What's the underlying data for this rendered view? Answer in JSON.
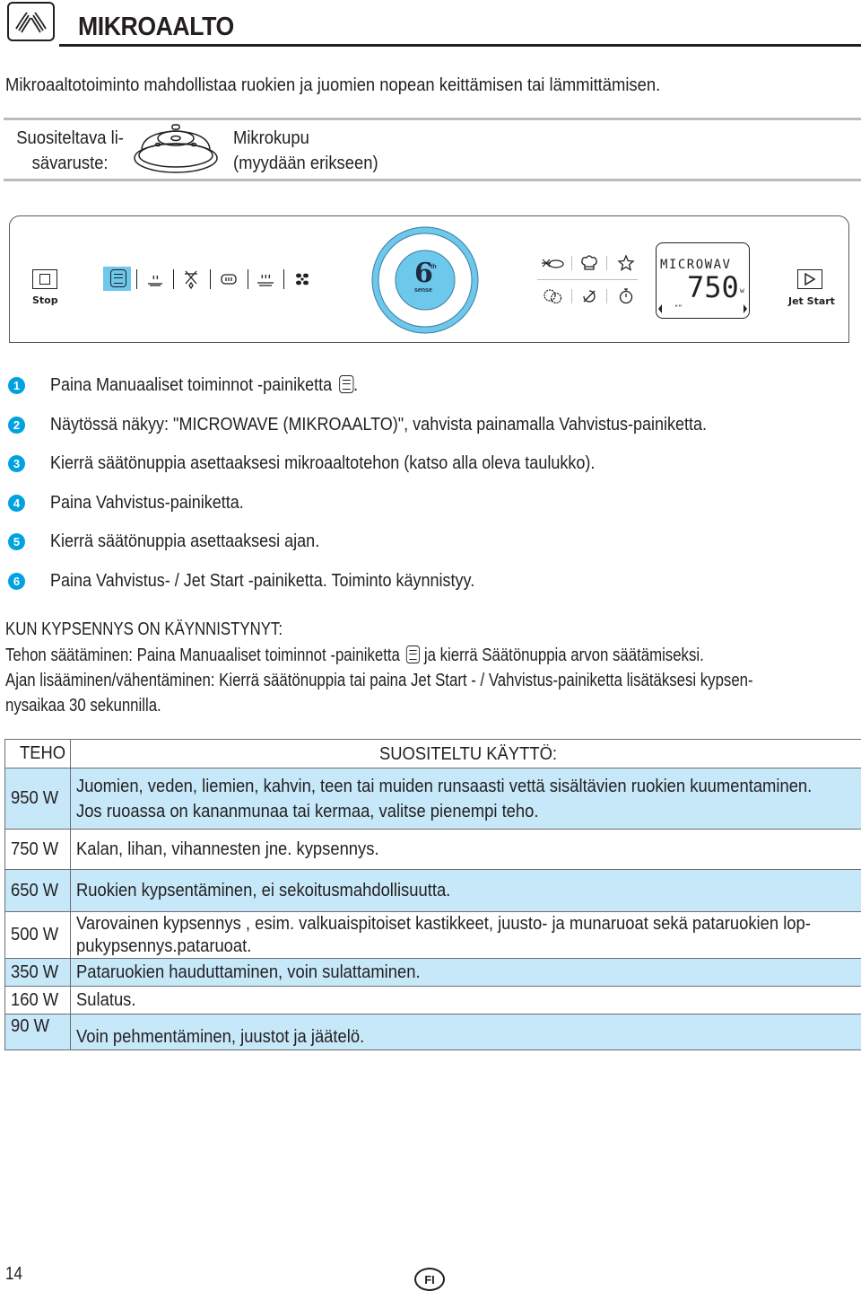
{
  "header": {
    "icon": "microwave-waves-icon",
    "title": "MIKROAALTO"
  },
  "intro": "Mikroaaltotoiminto mahdollistaa ruokien ja juomien nopean keittämisen tai lämmittämisen.",
  "accessory": {
    "label_line1": "Suositeltava li-",
    "label_line2": "sävaruste:",
    "image": "microwave-cover-icon",
    "name_line1": "Mikrokupu",
    "name_line2": "(myydään erikseen)"
  },
  "panel": {
    "stop_label": "Stop",
    "jet_start_label": "Jet Start",
    "function_icons": [
      "manual-functions-icon",
      "steam-icon",
      "defrost-icon",
      "grill-crisp-icon",
      "steam-crisp-icon",
      "fan-icon"
    ],
    "knob_label_main": "6",
    "knob_label_sup": "th",
    "knob_label_sub": "sense",
    "right_icons_top": [
      "bread-defrost-icon",
      "chef-hat-icon",
      "star-icon"
    ],
    "right_icons_bottom": [
      "gears-icon",
      "auto-clean-icon",
      "timer-icon"
    ],
    "display": {
      "text": "MICROWAV",
      "value": "750",
      "unit": "w"
    },
    "accent_color": "#6dc8ec"
  },
  "steps": [
    {
      "num": "1",
      "text": "Paina Manuaaliset toiminnot -painiketta",
      "suffix": "."
    },
    {
      "num": "2",
      "text": "Näytössä näkyy: \"MICROWAVE (MIKROAALTO)\", vahvista painamalla Vahvistus-painiketta."
    },
    {
      "num": "3",
      "text": "Kierrä säätönuppia asettaaksesi mikroaaltotehon (katso alla oleva taulukko)."
    },
    {
      "num": "4",
      "text": "Paina Vahvistus-painiketta."
    },
    {
      "num": "5",
      "text": "Kierrä säätönuppia  asettaaksesi ajan."
    },
    {
      "num": "6",
      "text": "Paina Vahvistus- / Jet Start -painiketta. Toiminto käynnistyy."
    }
  ],
  "after_start": {
    "heading": "KUN KYPSENNYS ON KÄYNNISTYNYT:",
    "power_adjust_before": "Tehon säätäminen: Paina Manuaaliset toiminnot -painiketta",
    "power_adjust_after": "ja kierrä Säätönuppia arvon säätämiseksi.",
    "time_adjust_line1": "Ajan lisääminen/vähentäminen: Kierrä säätönuppia tai paina Jet Start - / Vahvistus-painiketta lisätäksesi kypsen-",
    "time_adjust_line2": "nysaikaa 30 sekunnilla."
  },
  "table": {
    "header_power": "TEHO",
    "header_use": "SUOSITELTU KÄYTTÖ:",
    "rows": [
      {
        "power": "950 W",
        "use": [
          "Juomien, veden, liemien, kahvin, teen tai muiden runsaasti vettä sisältävien ruokien kuumentaminen.",
          "Jos ruoassa on kananmunaa tai kermaa, valitse pienempi teho."
        ]
      },
      {
        "power": "750 W",
        "use": [
          "Kalan, lihan, vihannesten jne. kypsennys."
        ]
      },
      {
        "power": "650 W",
        "use": [
          "Ruokien kypsentäminen, ei sekoitusmahdollisuutta."
        ]
      },
      {
        "power": "500 W",
        "use": [
          "Varovainen kypsennys , esim. valkuaispitoiset kastikkeet, juusto- ja munaruoat sekä pataruokien lop-",
          "pukypsennys.pataruoat."
        ]
      },
      {
        "power": "350 W",
        "use": [
          "Pataruokien hauduttaminen, voin sulattaminen."
        ]
      },
      {
        "power": "160 W",
        "use": [
          "Sulatus."
        ]
      },
      {
        "power": "90 W",
        "use": [
          "Voin pehmentäminen, juustot ja jäätelö."
        ]
      }
    ],
    "row_color": "#c6e8f8"
  },
  "footer": {
    "page_number": "14",
    "language": "FI"
  }
}
